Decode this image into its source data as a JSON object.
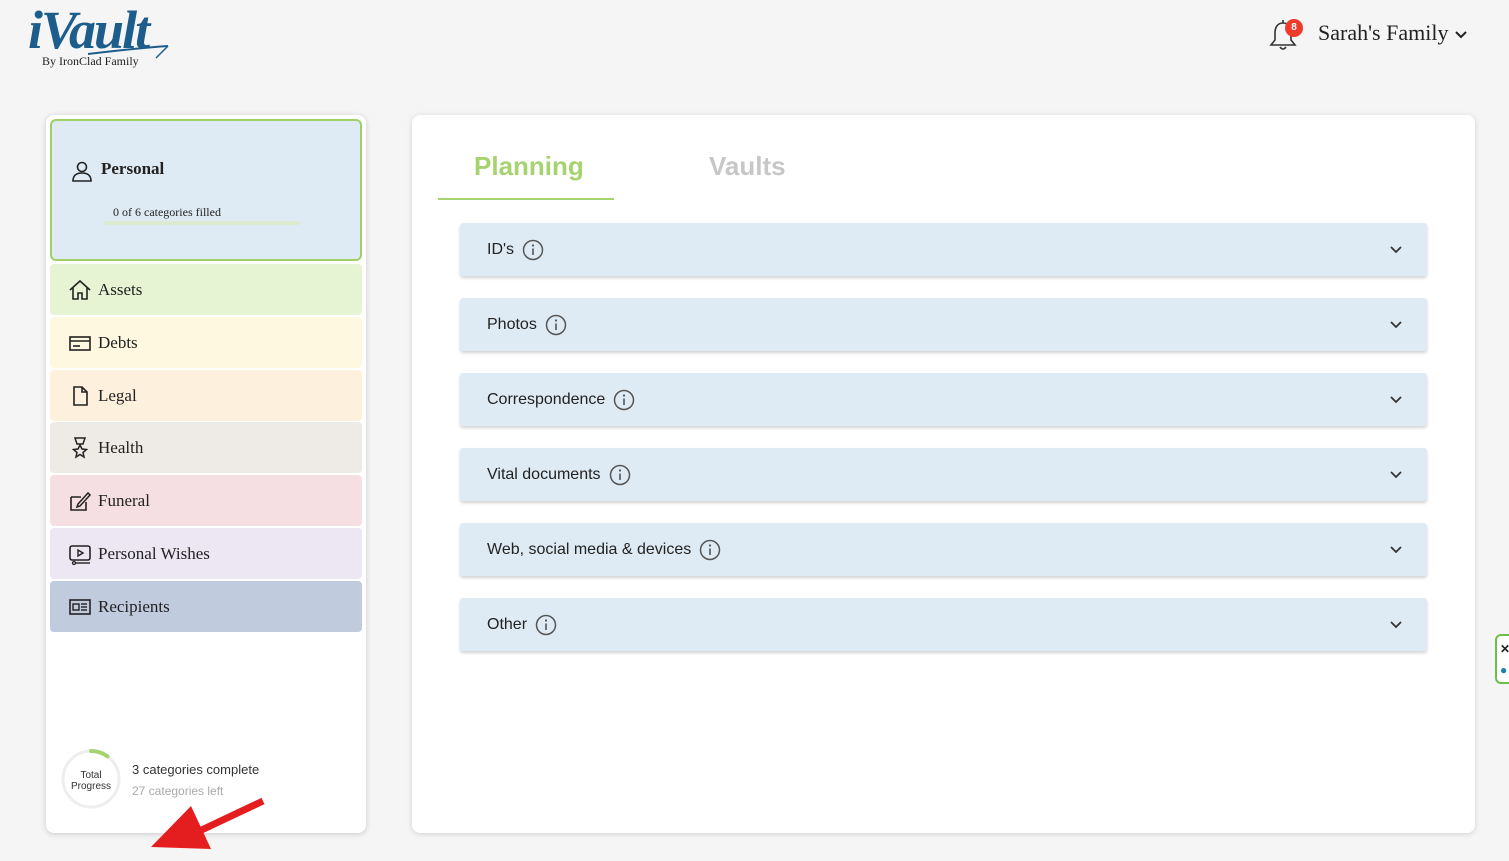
{
  "header": {
    "logo_text": "iVault",
    "logo_sub": "By IronClad Family",
    "notification_count": "8",
    "family_name": "Sarah's Family",
    "brand_color": "#1d5d8c"
  },
  "sidebar": {
    "personal": {
      "title": "Personal",
      "subtitle": "0 of 6 categories filled",
      "progress_fraction": 0
    },
    "categories": [
      {
        "label": "Assets",
        "icon": "home-icon",
        "color": "#e6f4d4"
      },
      {
        "label": "Debts",
        "icon": "credit-card-icon",
        "color": "#fdf8df"
      },
      {
        "label": "Legal",
        "icon": "document-icon",
        "color": "#fdf0dc"
      },
      {
        "label": "Health",
        "icon": "award-badge-icon",
        "color": "#eeeae6"
      },
      {
        "label": "Funeral",
        "icon": "edit-note-icon",
        "color": "#f6dfe3"
      },
      {
        "label": "Personal Wishes",
        "icon": "video-player-icon",
        "color": "#ede7f3"
      },
      {
        "label": "Recipients",
        "icon": "address-card-icon",
        "color": "#c1cbde"
      }
    ],
    "progress": {
      "ring_line1": "Total",
      "ring_line2": "Progress",
      "complete_text": "3 categories complete",
      "left_text": "27 categories left",
      "fraction": 0.1
    }
  },
  "tabs": [
    {
      "label": "Planning",
      "active": true
    },
    {
      "label": "Vaults",
      "active": false
    }
  ],
  "accordions": [
    {
      "label": "ID's"
    },
    {
      "label": "Photos"
    },
    {
      "label": "Correspondence"
    },
    {
      "label": "Vital documents"
    },
    {
      "label": "Web, social media & devices"
    },
    {
      "label": "Other"
    }
  ],
  "colors": {
    "accent_green": "#a6d36f",
    "accordion_bg": "#dfebf4",
    "annotation_arrow": "#e41e1e"
  }
}
